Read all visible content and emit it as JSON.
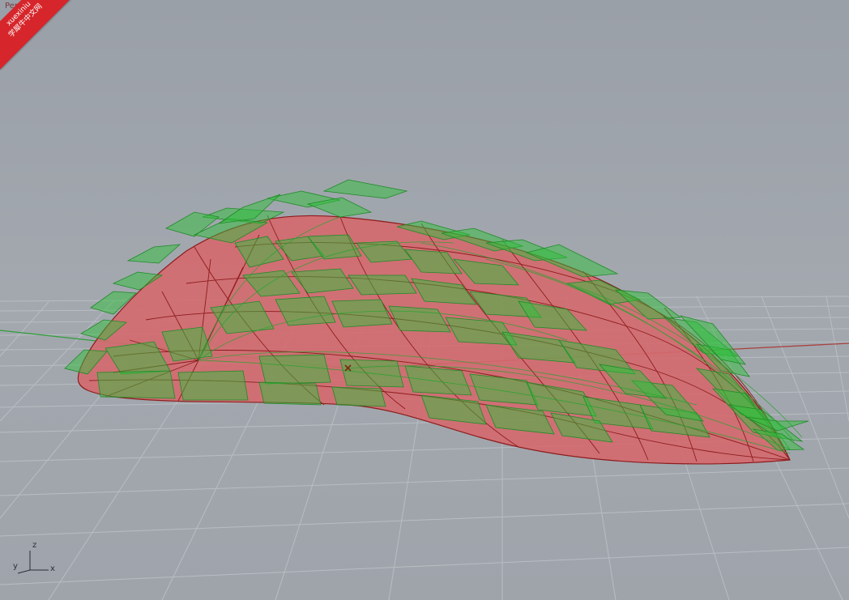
{
  "viewport": {
    "tab_label": "Perspective",
    "dropdown_icon": "chevron-down-icon"
  },
  "watermark": {
    "line1": "xuexiniu",
    "line2": "学犀牛中文网"
  },
  "axis_indicator": {
    "z_label": "z",
    "y_label": "y",
    "x_label": "x"
  },
  "colors": {
    "background": "#a0a5ac",
    "grid": "#b7bbc1",
    "surface": "#d46a6e",
    "panels": "#2fbf3b",
    "isocurve": "#9b1d1d",
    "watermark": "#d6262b"
  }
}
